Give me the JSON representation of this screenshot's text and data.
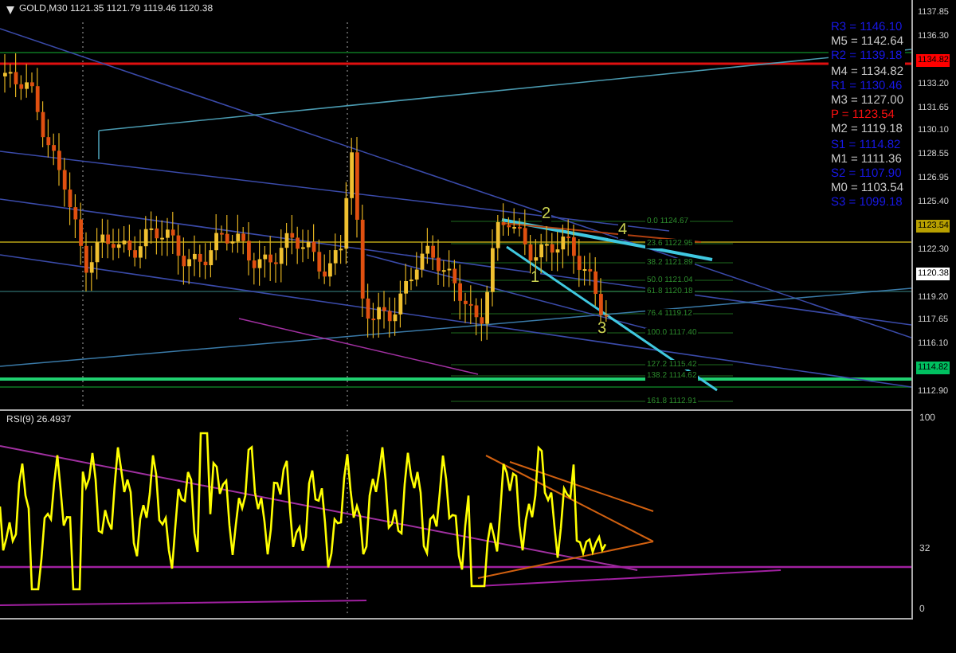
{
  "chart": {
    "symbol_header": "GOLD,M30  1121.35 1121.79 1119.46 1120.38",
    "pivot_levels": [
      {
        "text": "R3 = 1146.10",
        "kind": "resistance"
      },
      {
        "text": "M5 = 1142.64",
        "kind": "mid"
      },
      {
        "text": "R2 = 1139.18",
        "kind": "resistance"
      },
      {
        "text": "M4 = 1134.82",
        "kind": "mid"
      },
      {
        "text": "R1 = 1130.46",
        "kind": "resistance"
      },
      {
        "text": "M3 = 1127.00",
        "kind": "mid"
      },
      {
        "text": "P  = 1123.54",
        "kind": "pivot"
      },
      {
        "text": "M2 = 1119.18",
        "kind": "mid"
      },
      {
        "text": "S1 = 1114.82",
        "kind": "support"
      },
      {
        "text": "M1 = 1111.36",
        "kind": "mid"
      },
      {
        "text": "S2 = 1107.90",
        "kind": "support"
      },
      {
        "text": "M0 = 1103.54",
        "kind": "mid"
      },
      {
        "text": "S3 = 1099.18",
        "kind": "support"
      }
    ],
    "wave_labels": [
      "1",
      "2",
      "3",
      "4"
    ],
    "fib_labels": [
      "0.0 1124.67",
      "23.6 1122.95",
      "38.2 1121.89",
      "50.0 1121.04",
      "61.8 1120.18",
      "76.4 1119.12",
      "100.0 1117.40",
      "127.2 1115.42",
      "138.2 1114.62",
      "161.8 1112.91"
    ],
    "price_axis": [
      {
        "text": "1137.85"
      },
      {
        "text": "1136.30"
      },
      {
        "text": "1134.82",
        "color": "#ff0000"
      },
      {
        "text": "1133.20"
      },
      {
        "text": "1131.65"
      },
      {
        "text": "1130.10"
      },
      {
        "text": "1128.55"
      },
      {
        "text": "1126.95"
      },
      {
        "text": "1125.40"
      },
      {
        "text": "1123.54",
        "color": "#b8a000"
      },
      {
        "text": "1122.30"
      },
      {
        "text": "1120.38",
        "color": "#ffffff"
      },
      {
        "text": "1119.20"
      },
      {
        "text": "1117.65"
      },
      {
        "text": "1116.10"
      },
      {
        "text": "1114.82",
        "color": "#00c060"
      },
      {
        "text": "1112.90"
      }
    ]
  },
  "rsi": {
    "label": "RSI(9) 26.4937",
    "axis": [
      "100",
      "32",
      "0"
    ]
  }
}
